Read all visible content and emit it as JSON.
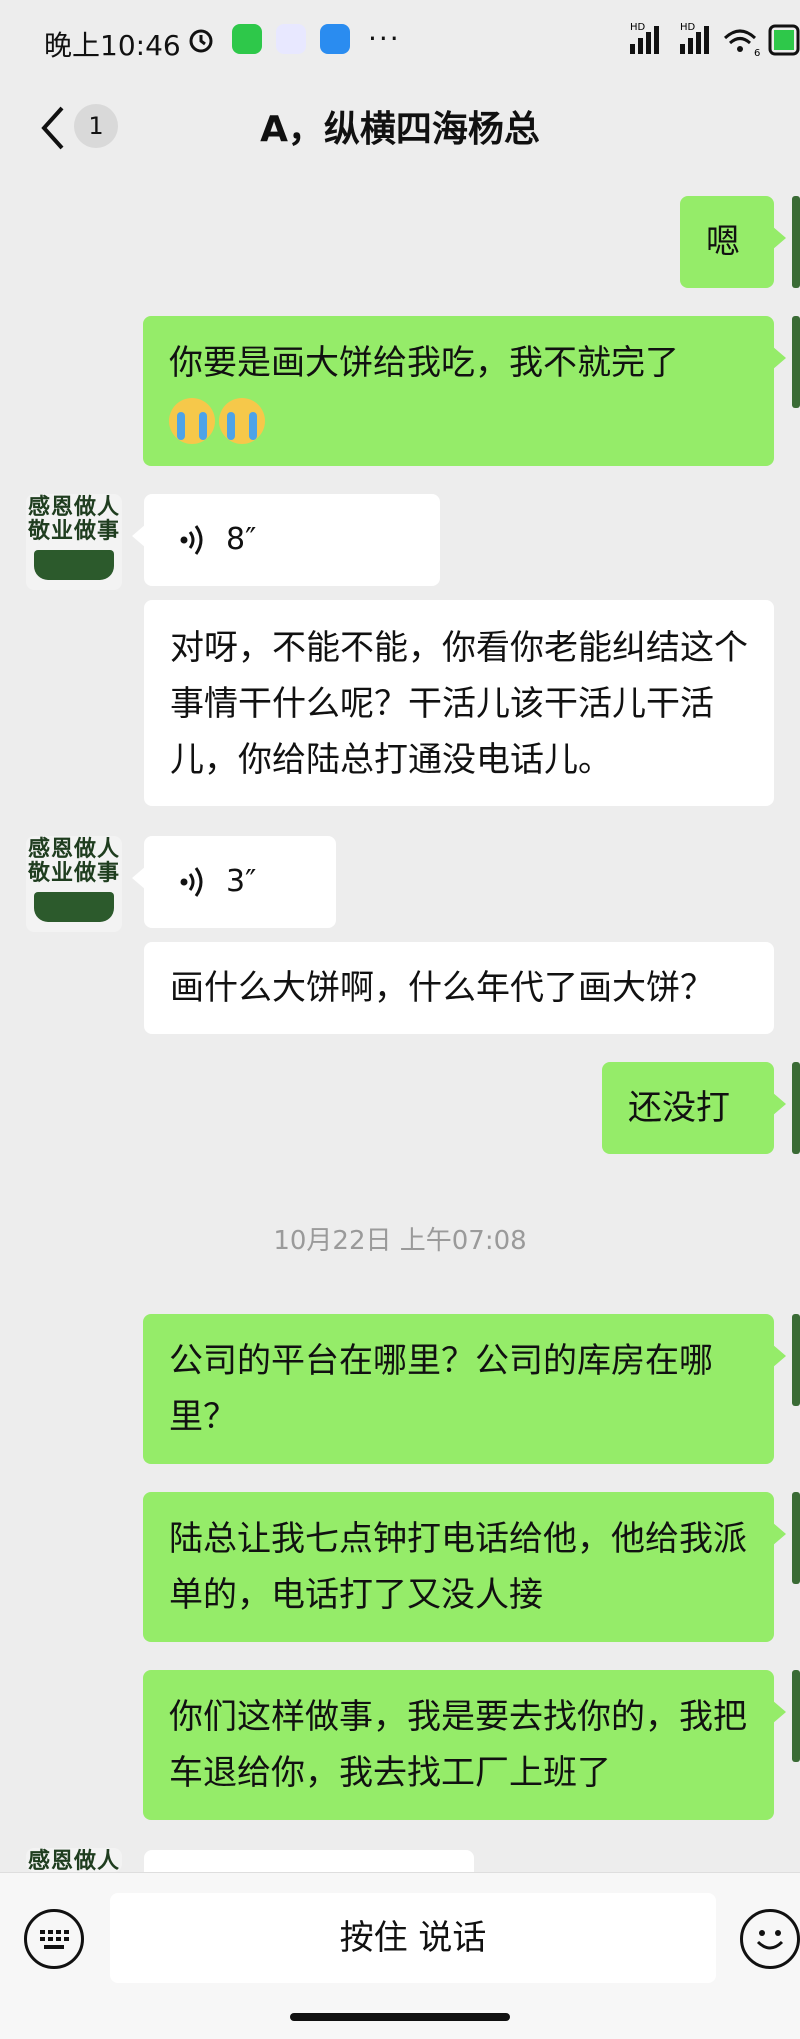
{
  "status_bar": {
    "time": "晚上10:46",
    "more": "···",
    "signal1": "HD",
    "signal2": "HD",
    "wifi_badge": "6"
  },
  "nav": {
    "unread_count": "1",
    "title": "A，纵横四海杨总"
  },
  "avatar_text": "感恩做人\n敬业做事",
  "messages": [
    {
      "side": "me",
      "text": "嗯"
    },
    {
      "side": "me",
      "text": "你要是画大饼给我吃，我不就完了"
    },
    {
      "side": "other",
      "voice_duration": "8″"
    },
    {
      "side": "other",
      "text": "对呀，不能不能，你看你老能纠结这个事情干什么呢？干活儿该干活儿干活儿，你给陆总打通没电话儿。"
    },
    {
      "side": "other",
      "voice_duration": "3″"
    },
    {
      "side": "other",
      "text": "画什么大饼啊，什么年代了画大饼？"
    },
    {
      "side": "me",
      "text": "还没打"
    },
    {
      "side": "me",
      "text": "公司的平台在哪里？公司的库房在哪里？"
    },
    {
      "side": "me",
      "text": "陆总让我七点钟打电话给他，他给我派单的，电话打了又没人接"
    },
    {
      "side": "me",
      "text": "你们这样做事，我是要去找你的，我把车退给你，我去找工厂上班了"
    }
  ],
  "timestamp": "10月22日 上午07:08",
  "input_bar": {
    "hold_to_talk": "按住 说话"
  },
  "colors": {
    "me_bubble": "#95ec69",
    "other_bubble": "#ffffff",
    "background": "#ededed"
  }
}
